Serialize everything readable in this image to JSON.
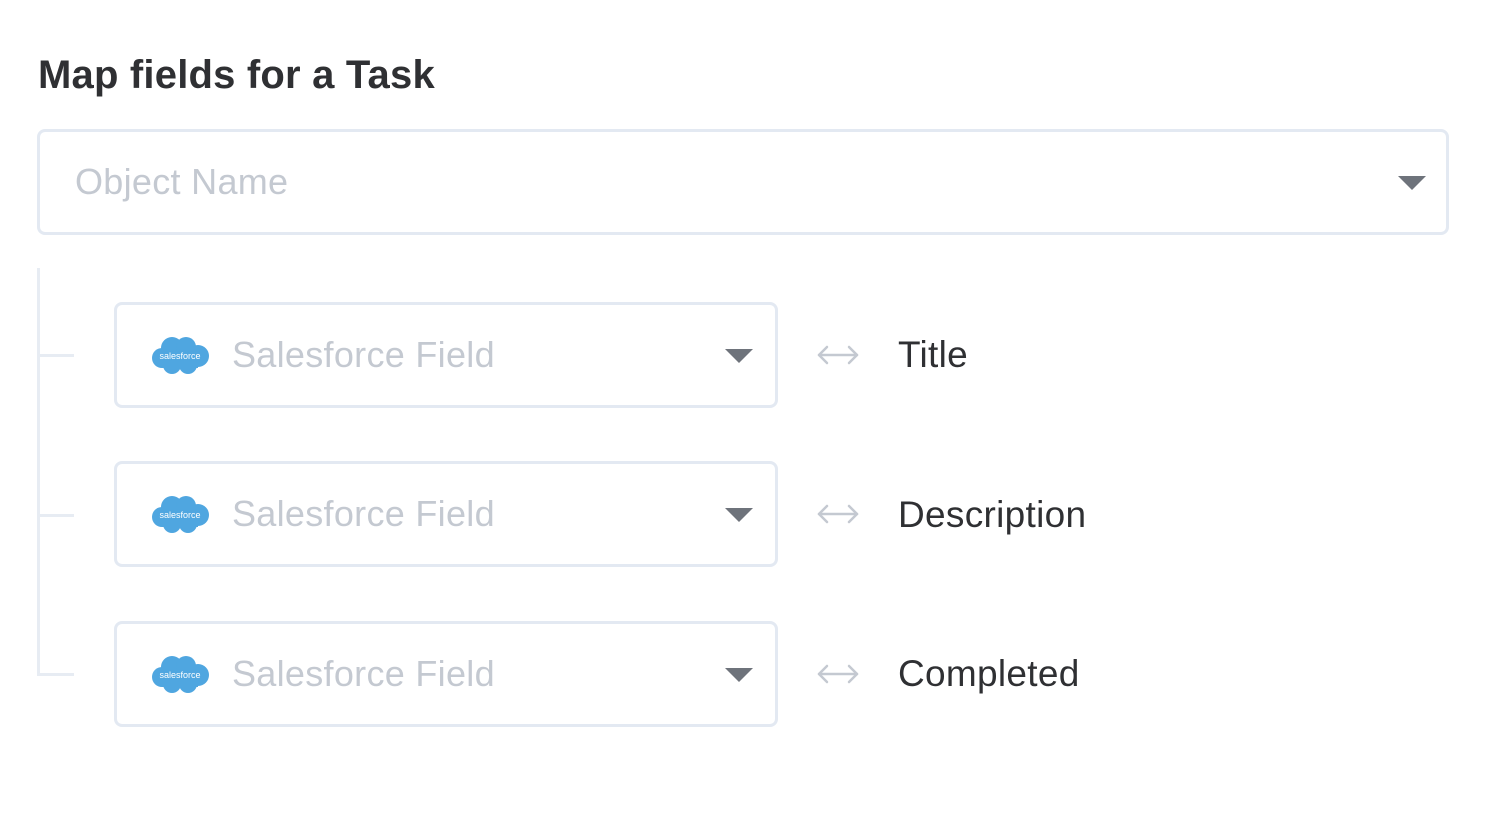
{
  "page": {
    "title": "Map fields for a Task"
  },
  "object_select": {
    "placeholder": "Object Name",
    "icon": "chevron-down-icon"
  },
  "mappings": [
    {
      "field_placeholder": "Salesforce Field",
      "logo_text": "salesforce",
      "arrow_icon": "left-right-arrow-icon",
      "label": "Title"
    },
    {
      "field_placeholder": "Salesforce Field",
      "logo_text": "salesforce",
      "arrow_icon": "left-right-arrow-icon",
      "label": "Description"
    },
    {
      "field_placeholder": "Salesforce Field",
      "logo_text": "salesforce",
      "arrow_icon": "left-right-arrow-icon",
      "label": "Completed"
    }
  ],
  "colors": {
    "border": "#e3e9f2",
    "placeholder": "#c4c9d1",
    "text": "#2f3033",
    "caret": "#6e737b",
    "salesforce_blue": "#4fa6e0"
  }
}
